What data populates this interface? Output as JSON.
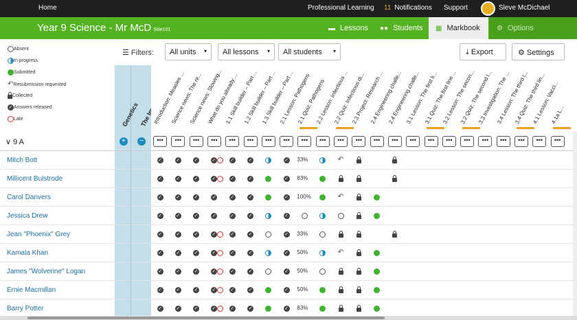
{
  "topbar": {
    "home": "Home",
    "professional_learning": "Professional Learning",
    "notifications_count": "11",
    "notifications_label": "Notifications",
    "support": "Support",
    "user_name": "Sleve McDichael"
  },
  "header": {
    "title": "Year 9 Science - Mr McD",
    "subtitle": "Stile101",
    "tabs": {
      "lessons": "Lessons",
      "students": "Students",
      "markbook": "Markbook",
      "options": "Options"
    }
  },
  "legend": [
    {
      "icon": "absent-icon",
      "label": "Absent"
    },
    {
      "icon": "in-progress-icon",
      "label": "In progress"
    },
    {
      "icon": "submitted-icon",
      "label": "Submitted"
    },
    {
      "icon": "resubmission-icon",
      "label": "Resubmission requested"
    },
    {
      "icon": "lock-icon",
      "label": "Collected"
    },
    {
      "icon": "check-icon",
      "label": "Answers released"
    },
    {
      "icon": "late-icon",
      "label": "Late"
    }
  ],
  "filters": {
    "label": "Filters:",
    "units": "All units",
    "lessons": "All lessons",
    "students": "All students",
    "export": "Export",
    "settings": "Settings"
  },
  "units": {
    "genetics": "Genetics",
    "immune": "The Immune System"
  },
  "columns": [
    "Introduction: Measles ...",
    "Science news: The re...",
    "Science news: Slowing...",
    "What do you already ...",
    "1.1 Skill builder – Part ...",
    "1.2 Skill builder – Part ...",
    "1.3 Skill builder – Part ...",
    "2.1 Lesson: Pathogens",
    "2.1 Quiz: Pathogens",
    "2.2 Lesson: Infectious ...",
    "2.2 Quiz: Infectious di...",
    "2.3 Project: Research ...",
    "2.4 Engineering challe...",
    "2.4 Engineering challe...",
    "3.1 Lesson: The first li...",
    "3.1 Quiz: The first line ...",
    "3.2 Lesson: The secon...",
    "3.2 Quiz: The second l...",
    "3.3 Investigation: The ...",
    "3.4 Lesson: The third l...",
    "3.4 Quiz: The third lin...",
    "4.1 Lesson: Vacci...",
    "4.1a L..."
  ],
  "group": {
    "label": "9 A"
  },
  "rows": [
    {
      "name": "Mitch Bott",
      "cells": [
        "chk",
        "chk",
        "chk",
        "chklate",
        "chk",
        "chk",
        "prog",
        "chk",
        "33%",
        "prog",
        "resub",
        "lock",
        "",
        "lock"
      ]
    },
    {
      "name": "Millicent Bulstrode",
      "cells": [
        "chk",
        "chk",
        "chk",
        "chklate",
        "chk",
        "chk",
        "sub",
        "chk",
        "83%",
        "sub",
        "lock",
        "lock",
        "",
        "lock"
      ]
    },
    {
      "name": "Carol Danvers",
      "cells": [
        "chk",
        "chk",
        "chk",
        "chk",
        "chk",
        "chk",
        "sub",
        "chk",
        "100%",
        "sub",
        "resub",
        "lock",
        "sub",
        ""
      ]
    },
    {
      "name": "Jessica Drew",
      "cells": [
        "chk",
        "chk",
        "chk",
        "chk",
        "chk",
        "chk",
        "prog",
        "chk",
        "abs",
        "prog",
        "abs",
        "lock",
        "sub",
        ""
      ]
    },
    {
      "name": "Jean \"Phoenix\" Grey",
      "cells": [
        "chk",
        "chk",
        "chk",
        "chklate",
        "chk",
        "chk",
        "abs",
        "chk",
        "33%",
        "abs",
        "lock",
        "lock",
        "",
        "lock"
      ]
    },
    {
      "name": "Kamala Khan",
      "cells": [
        "chk",
        "chk",
        "chk",
        "chklate",
        "chk",
        "chk",
        "prog",
        "chk",
        "50%",
        "prog",
        "resub",
        "lock",
        "sub",
        ""
      ]
    },
    {
      "name": "James \"Wolverine\" Logan",
      "cells": [
        "chk",
        "chk",
        "chk",
        "chklate",
        "chk",
        "chk",
        "abs",
        "chk",
        "50%",
        "abs",
        "lock",
        "lock",
        "sub",
        ""
      ]
    },
    {
      "name": "Ernie Macmillan",
      "cells": [
        "chk",
        "chk",
        "chk",
        "chklate",
        "chk",
        "chk",
        "sub",
        "chk",
        "50%",
        "sub",
        "lock",
        "lock",
        "sub",
        ""
      ]
    },
    {
      "name": "Barry Potter",
      "cells": [
        "chk",
        "chk",
        "chk",
        "chklate",
        "chk",
        "chk",
        "sub",
        "chk",
        "83%",
        "sub",
        "lock",
        "lock",
        "sub",
        ""
      ]
    }
  ],
  "colors": {
    "green": "#52b220",
    "accent": "#1d8bbf",
    "submitted": "#3db32f",
    "late": "#e03030",
    "bar": "#f0a020"
  }
}
